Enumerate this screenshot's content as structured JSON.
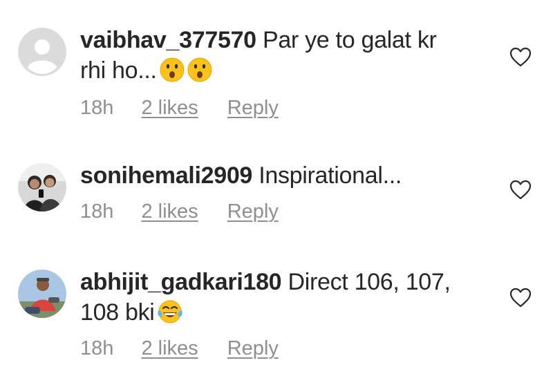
{
  "comments": [
    {
      "username": "vaibhav_377570",
      "text_line1": " Par ye to galat kr",
      "text_line2": "rhi ho...",
      "emojis": [
        "astonished-face-emoji",
        "astonished-face-emoji"
      ],
      "time": "18h",
      "likes": "2 likes",
      "reply": "Reply",
      "avatar": "default-avatar"
    },
    {
      "username": "sonihemali2909",
      "text_line1": " Inspirational...",
      "text_line2": "",
      "emojis": [],
      "time": "18h",
      "likes": "2 likes",
      "reply": "Reply",
      "avatar": "photo-avatar"
    },
    {
      "username": "abhijit_gadkari180",
      "text_line1": " Direct 106, 107,",
      "text_line2": "108 bki",
      "emojis": [
        "tears-of-joy-emoji"
      ],
      "time": "18h",
      "likes": "2 likes",
      "reply": "Reply",
      "avatar": "photo-avatar"
    }
  ],
  "colors": {
    "text": "#262626",
    "secondary": "#8e8e8e",
    "avatar_placeholder": "#dbdbdb"
  }
}
